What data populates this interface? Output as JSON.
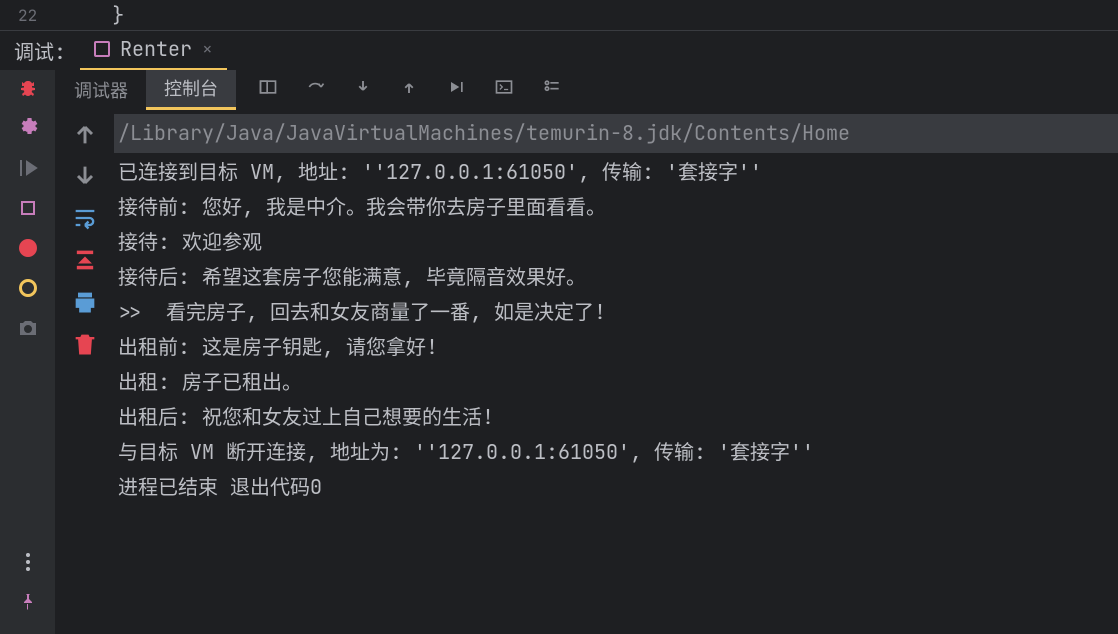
{
  "editor": {
    "line_number": "22",
    "brace": "}"
  },
  "debug": {
    "label": "调试:",
    "tab": {
      "label": "Renter",
      "close": "×"
    }
  },
  "subTabs": {
    "debugger": "调试器",
    "console": "控制台"
  },
  "console": {
    "path": "/Library/Java/JavaVirtualMachines/temurin-8.jdk/Contents/Home",
    "lines": [
      "已连接到目标 VM, 地址: ''127.0.0.1:61050', 传输: '套接字''",
      "接待前: 您好, 我是中介。我会带你去房子里面看看。",
      "接待: 欢迎参观",
      "接待后: 希望这套房子您能满意, 毕竟隔音效果好。",
      ">>  看完房子, 回去和女友商量了一番, 如是决定了!",
      "出租前: 这是房子钥匙, 请您拿好!",
      "出租: 房子已租出。",
      "出租后: 祝您和女友过上自己想要的生活!",
      "与目标 VM 断开连接, 地址为: ''127.0.0.1:61050', 传输: '套接字''",
      "",
      "进程已结束 退出代码0"
    ]
  }
}
